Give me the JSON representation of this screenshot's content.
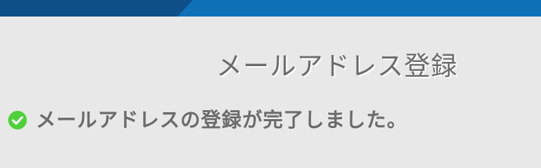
{
  "header": {
    "bar_color": "#0e71b8",
    "bar_dark_color": "#0d4f86"
  },
  "main": {
    "title": "メールアドレス登録",
    "success_message": "メールアドレスの登録が完了しました。",
    "success_icon": "check-circle-icon",
    "success_color": "#4cd137"
  }
}
